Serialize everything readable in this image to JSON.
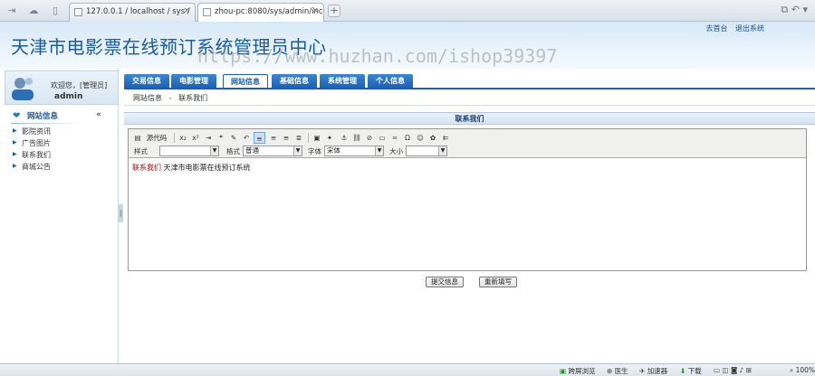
{
  "browser": {
    "tabs": [
      {
        "label": "127.0.0.1 / localhost / sys /"
      },
      {
        "label": "zhou-pc:8080/sys/admin/inc"
      }
    ],
    "new_tab_label": "+",
    "close_label": "×"
  },
  "header": {
    "title": "天津市电影票在线预订系统管理员中心",
    "watermark": "https://www.huzhan.com/ishop39397",
    "links": {
      "home": "去首台",
      "logout": "退出系统"
    }
  },
  "sidebar": {
    "welcome": "欢迎您，[管理员]",
    "username": "admin",
    "menu_title": "网站信息",
    "items": [
      {
        "label": "影院资讯"
      },
      {
        "label": "广告图片"
      },
      {
        "label": "联系我们"
      },
      {
        "label": "商城公告"
      }
    ]
  },
  "main": {
    "tabs": [
      {
        "label": "交易信息"
      },
      {
        "label": "电影管理"
      },
      {
        "label": "网站信息"
      },
      {
        "label": "基础信息"
      },
      {
        "label": "系统管理"
      },
      {
        "label": "个人信息"
      }
    ],
    "breadcrumb": {
      "parent": "网站信息",
      "sep": "-",
      "current": "联系我们"
    },
    "panel_title": "联系我们",
    "editor": {
      "source_label": "源代码",
      "style_label": "样式",
      "format_label": "格式",
      "format_value": "普通",
      "font_label": "字体",
      "font_value": "宋体",
      "size_label": "大小",
      "content_highlight": "联系我们",
      "content_text": "天津市电影票在线预订系统"
    },
    "buttons": {
      "submit": "提交信息",
      "reset": "重新填写"
    }
  },
  "statusbar": {
    "items": [
      {
        "label": "跨屏浏览"
      },
      {
        "label": "医生"
      },
      {
        "label": "加速器"
      },
      {
        "label": "下载"
      },
      {
        "label": "100%"
      }
    ]
  }
}
